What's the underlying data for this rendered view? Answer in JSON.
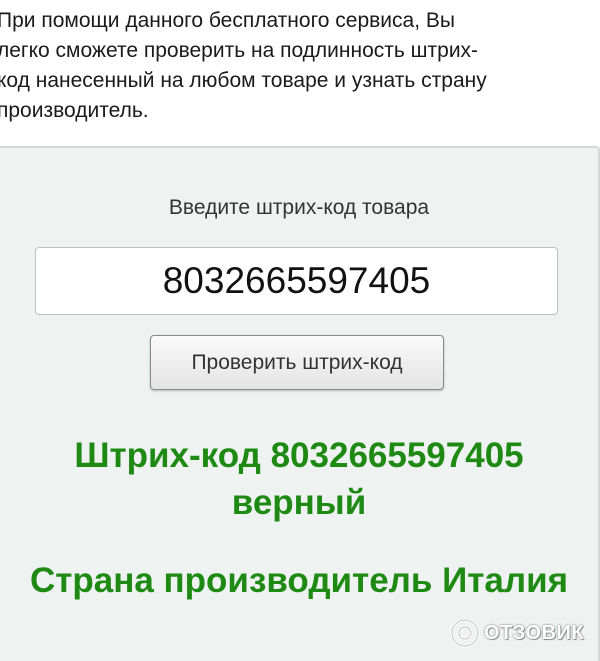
{
  "intro": {
    "lines": [
      "При помощи данного бесплатного сервиса, Вы",
      "легко сможете проверить на подлинность штрих-",
      "код нанесенный на любом товаре и узнать страну",
      "производитель."
    ]
  },
  "form": {
    "prompt": "Введите штрих-код товара",
    "barcode_value": "8032665597405",
    "check_button_label": "Проверить штрих-код"
  },
  "result": {
    "line1": "Штрих-код 8032665597405",
    "line2": "верный",
    "country": "Страна производитель Италия"
  },
  "watermark": {
    "icon": "otzovik-logo-icon",
    "text": "ОТЗОВИК"
  },
  "colors": {
    "result_green": "#1e8a14",
    "panel_background": "#eef3f1"
  }
}
